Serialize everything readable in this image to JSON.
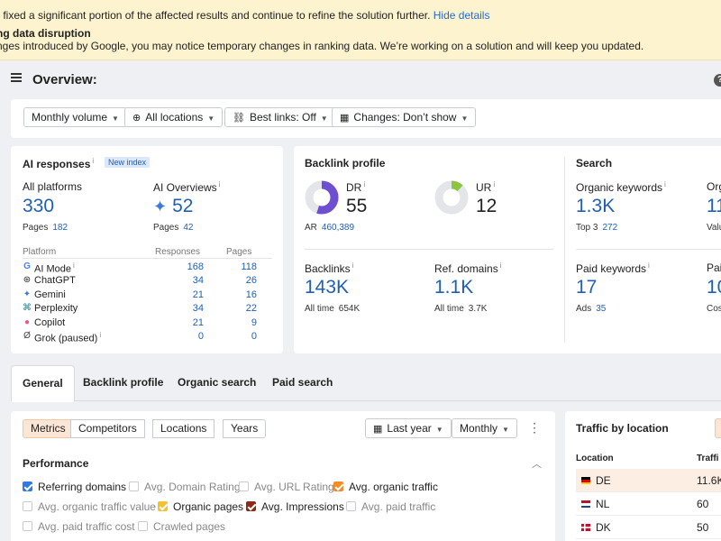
{
  "banner": {
    "line1": "y fixed a significant portion of the affected results and continue to refine the solution further.",
    "line1_link": "Hide details",
    "line2": "ng data disruption",
    "line3": "nges introduced by Google, you may notice temporary changes in ranking data. We’re working on a solution and will keep you updated."
  },
  "header": {
    "title": "Overview:",
    "help_glyph": "?"
  },
  "filters": [
    {
      "label": "Monthly volume",
      "icon": "",
      "icon_name": ""
    },
    {
      "label": "All locations",
      "icon": "⊕",
      "icon_name": "globe-icon"
    },
    {
      "label": "Best links: Off",
      "icon": "⛓",
      "icon_name": "link-icon"
    },
    {
      "label": "Changes: Don’t show",
      "icon": "▦",
      "icon_name": "calendar-icon"
    }
  ],
  "ai": {
    "title": "AI responses",
    "title_sup": "i",
    "badge": "New index",
    "all_platforms_label": "All platforms",
    "all_platforms_value": "330",
    "pages_label": "Pages",
    "pages_value": "182",
    "overviews_label": "AI Overviews",
    "overviews_value": "52",
    "overviews_pages_label": "Pages",
    "overviews_pages_value": "42",
    "col_platform": "Platform",
    "col_responses": "Responses",
    "col_pages": "Pages",
    "rows": [
      {
        "name": "AI Mode",
        "sup": "i",
        "icon": "G",
        "icon_name": "google-icon",
        "responses": "168",
        "pages": "118"
      },
      {
        "name": "ChatGPT",
        "sup": "",
        "icon": "⊛",
        "icon_name": "chatgpt-icon",
        "responses": "34",
        "pages": "26"
      },
      {
        "name": "Gemini",
        "sup": "",
        "icon": "✦",
        "icon_name": "gemini-icon",
        "responses": "21",
        "pages": "16"
      },
      {
        "name": "Perplexity",
        "sup": "",
        "icon": "⌘",
        "icon_name": "perplexity-icon",
        "responses": "34",
        "pages": "22"
      },
      {
        "name": "Copilot",
        "sup": "",
        "icon": "●",
        "icon_name": "copilot-icon",
        "responses": "21",
        "pages": "9"
      },
      {
        "name": "Grok (paused)",
        "sup": "i",
        "icon": "Ø",
        "icon_name": "grok-icon",
        "responses": "0",
        "pages": "0"
      }
    ]
  },
  "backlink": {
    "title": "Backlink profile",
    "dr_label": "DR",
    "dr_value": "55",
    "ar_label": "AR",
    "ar_value": "460,389",
    "ur_label": "UR",
    "ur_value": "12",
    "backlinks_label": "Backlinks",
    "backlinks_value": "143K",
    "backlinks_sub_label": "All time",
    "backlinks_sub_value": "654K",
    "refdomains_label": "Ref. domains",
    "refdomains_value": "1.1K",
    "refdomains_sub_label": "All time",
    "refdomains_sub_value": "3.7K",
    "dr_fraction": 0.55,
    "ur_fraction": 0.12
  },
  "search": {
    "title": "Search",
    "organic_kw_label": "Organic keywords",
    "organic_kw_value": "1.3K",
    "top3_label": "Top 3",
    "top3_value": "272",
    "org_cut_label": "Org",
    "org_cut_value": "11",
    "valu_cut": "Valu",
    "paid_kw_label": "Paid keywords",
    "paid_kw_value": "17",
    "ads_label": "Ads",
    "ads_value": "35",
    "paid_cut_label": "Paid",
    "paid_cut_value": "10",
    "cos_cut": "Cos"
  },
  "tabs": [
    "General",
    "Backlink profile",
    "Organic search",
    "Paid search"
  ],
  "metrics_toolbar": {
    "segments": [
      "Metrics",
      "Competitors",
      "Locations",
      "Years"
    ],
    "date_label": "Last year",
    "granularity_label": "Monthly"
  },
  "performance": {
    "title": "Performance",
    "checks": [
      {
        "label": "Referring domains",
        "checked": true,
        "color": "#2f7ae5"
      },
      {
        "label": "Avg. Domain Rating",
        "checked": false,
        "color": ""
      },
      {
        "label": "Avg. URL Rating",
        "checked": false,
        "color": ""
      },
      {
        "label": "Avg. organic traffic",
        "checked": true,
        "color": "#f28c28"
      },
      {
        "label": "Avg. organic traffic value",
        "checked": false,
        "color": ""
      },
      {
        "label": "Organic pages",
        "checked": true,
        "color": "#f2c230"
      },
      {
        "label": "Avg. Impressions",
        "checked": true,
        "color": "#8b2a1a"
      },
      {
        "label": "Avg. paid traffic",
        "checked": false,
        "color": ""
      },
      {
        "label": "Avg. paid traffic cost",
        "checked": false,
        "color": ""
      },
      {
        "label": "Crawled pages",
        "checked": false,
        "color": ""
      }
    ]
  },
  "traffic": {
    "title": "Traffic by location",
    "col_location": "Location",
    "col_traffic": "Traffi",
    "rows": [
      {
        "code": "DE",
        "value": "11.6K",
        "flag": "de"
      },
      {
        "code": "NL",
        "value": "60",
        "flag": "nl"
      },
      {
        "code": "DK",
        "value": "50",
        "flag": "dk"
      }
    ]
  },
  "colors": {
    "accent_blue": "#1f5fb8",
    "banner_bg": "#fdf3cf",
    "dr_purple": "#6f4fd1",
    "ur_green": "#8cc63f"
  }
}
